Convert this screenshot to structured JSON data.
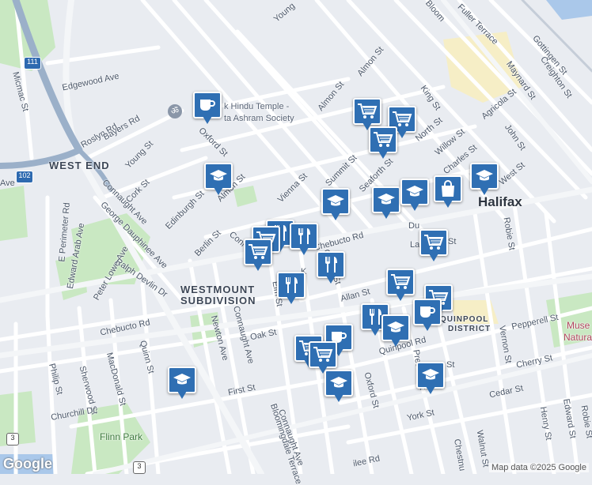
{
  "map": {
    "areas": {
      "west_end": "WEST END",
      "westmount_1": "WESTMOUNT",
      "westmount_2": "SUBDIVISION",
      "halifax": "Halifax",
      "quinpool_1": "QUINPOOL",
      "quinpool_2": "DISTRICT"
    },
    "parks": {
      "flinn": "Flinn Park"
    },
    "museum": {
      "line1": "Muse",
      "line2": "Natural H"
    },
    "poi": {
      "temple_line1": "k Hindu Temple -",
      "temple_line2": "ta Ashram Society"
    },
    "streets": {
      "young": "Young",
      "young2": "Young St",
      "bloom": "Bloom",
      "fuller": "Fuller Terrace",
      "gottingen": "Gottingen St",
      "creighton": "Creighton St",
      "maynard": "Maynard St",
      "agricola": "Agricola St",
      "john": "John St",
      "king": "King St",
      "almon": "Almon St",
      "almon2": "Almon St",
      "north": "North St",
      "willow": "Willow St",
      "charles": "Charles St",
      "west": "West St",
      "robie": "Robie St",
      "robie2": "Robie St",
      "summit": "Summit St",
      "seaforth": "Seaforth St",
      "vienna": "Vienna St",
      "oxford": "Oxford St",
      "oxford2": "Oxford St",
      "oxford3": "Oxford St",
      "edinburgh": "Edinburgh St",
      "berlin": "Berlin St",
      "conn_short": "Conn",
      "chebucto": "Chebucto Rd",
      "chebucto2": "Chebucto Rd",
      "allan": "Allan St",
      "elm": "Elm St",
      "oak": "Oak St",
      "quinpool": "Quinpool Rd",
      "pepperell": "Pepperell St",
      "cherry": "Cherry St",
      "cedar": "Cedar St",
      "vernon": "Vernon St",
      "preston": "Preston St",
      "york": "York St",
      "walnut": "Walnut St",
      "chestnut": "Chestnu",
      "henry": "Henry St",
      "edward": "Edward St",
      "edgewood": "Edgewood Ave",
      "micmac": "Micmac St",
      "roslyn": "Roslyn Rd",
      "bayers": "Bayers Rd",
      "cork": "Cork St",
      "connaught": "Connaught Ave",
      "connaught2": "Connaught Ave",
      "connaught3": "Connaught Ave",
      "george": "George Dauphinee Ave",
      "eperimeter": "E Perimeter Rd",
      "edwardarab": "Edward Arab Ave",
      "peterlowe": "Peter Lowe Ave",
      "ralph": "Ralph Devlin Dr",
      "newton": "Newton Ave",
      "quinn": "Quinn St",
      "macdonald": "MacDonald St",
      "philip": "Philip St",
      "sherwood": "Sherwood St",
      "churchill": "Churchill Dr",
      "first": "First St",
      "bloomingdale": "Bloomingdale Terrace",
      "jubilee": "ilee Rd",
      "ave": "Ave",
      "dut": "Du",
      "lat": "La",
      "st_frag": "St",
      "k_frag": "K",
      "st_frag2": "St"
    },
    "shields": {
      "s111": "111",
      "s102": "102",
      "s3": "3",
      "s3b": "3"
    },
    "attribution": "Map data ©2025 Google",
    "logo": "Google"
  },
  "markers": [
    {
      "type": "cafe-icon"
    },
    {
      "type": "school-icon"
    },
    {
      "type": "restaurant-icon"
    },
    {
      "type": "restaurant-icon"
    },
    {
      "type": "shopping-cart-icon"
    },
    {
      "type": "shopping-cart-icon"
    },
    {
      "type": "restaurant-icon"
    },
    {
      "type": "restaurant-icon"
    },
    {
      "type": "shopping-cart-icon"
    },
    {
      "type": "shopping-cart-icon"
    },
    {
      "type": "shopping-cart-icon"
    },
    {
      "type": "school-icon"
    },
    {
      "type": "school-icon"
    },
    {
      "type": "school-icon"
    },
    {
      "type": "shopping-bag-icon"
    },
    {
      "type": "school-icon"
    },
    {
      "type": "shopping-cart-icon"
    },
    {
      "type": "shopping-cart-icon"
    },
    {
      "type": "shopping-cart-icon"
    },
    {
      "type": "cafe-icon"
    },
    {
      "type": "restaurant-icon"
    },
    {
      "type": "school-icon"
    },
    {
      "type": "shopping-cart-icon"
    },
    {
      "type": "cafe-icon"
    },
    {
      "type": "shopping-cart-icon"
    },
    {
      "type": "school-icon"
    },
    {
      "type": "school-icon"
    },
    {
      "type": "school-icon"
    }
  ],
  "colors": {
    "marker": "#2f6fb3",
    "park": "#c9e8c2",
    "road": "#ffffff",
    "highway": "#9bb0c9",
    "water": "#aac8ea"
  }
}
